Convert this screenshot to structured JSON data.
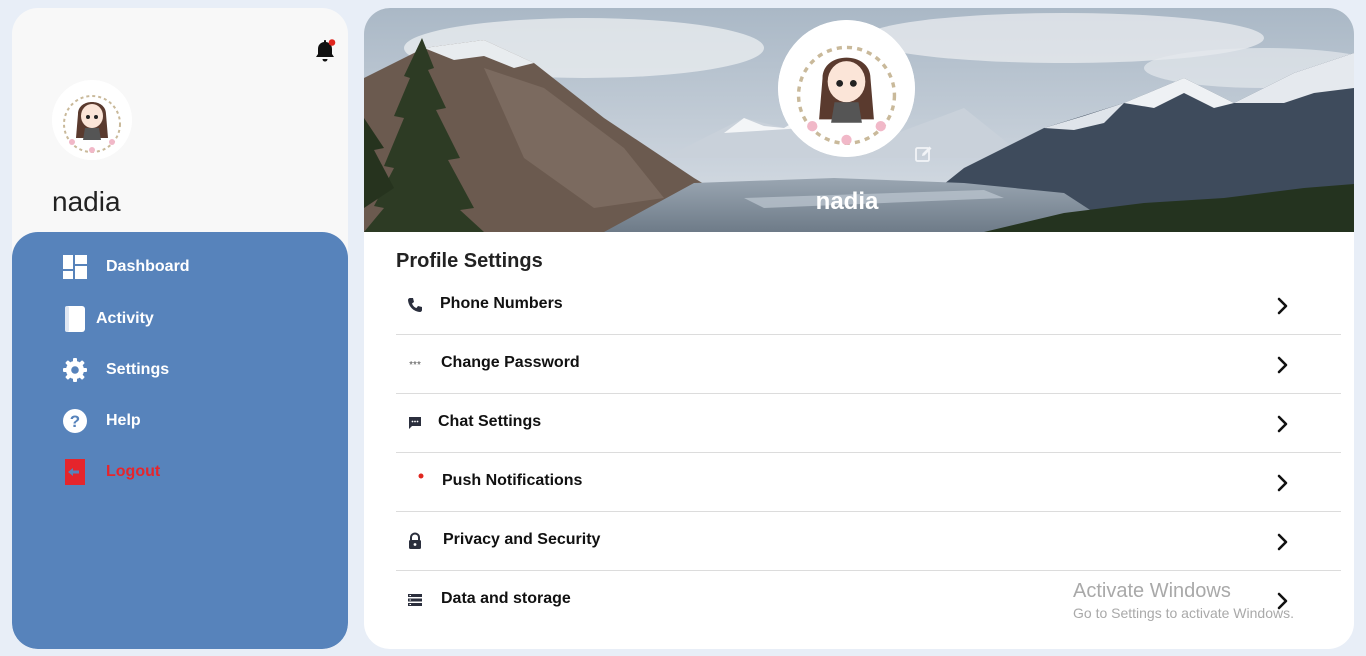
{
  "sidebar": {
    "user_name": "nadia",
    "nav": [
      {
        "label": "Dashboard",
        "icon": "dashboard-icon"
      },
      {
        "label": "Activity",
        "icon": "book-icon"
      },
      {
        "label": "Settings",
        "icon": "gear-icon"
      },
      {
        "label": "Help",
        "icon": "question-icon"
      },
      {
        "label": "Logout",
        "icon": "logout-icon"
      }
    ]
  },
  "profile": {
    "name": "nadia"
  },
  "settings": {
    "title": "Profile Settings",
    "items": [
      {
        "label": "Phone Numbers",
        "icon": "phone-icon"
      },
      {
        "label": "Change Password",
        "icon": "password-dots-icon"
      },
      {
        "label": "Chat Settings",
        "icon": "chat-icon"
      },
      {
        "label": "Push Notifications",
        "icon": "notification-dot-icon"
      },
      {
        "label": "Privacy and Security",
        "icon": "lock-icon"
      },
      {
        "label": "Data and storage",
        "icon": "storage-icon"
      }
    ]
  },
  "watermark": {
    "line1": "Activate Windows",
    "line2": "Go to Settings to activate Windows."
  },
  "colors": {
    "sidebar_nav_bg": "#5783bb",
    "logout_red": "#e5252c",
    "page_bg": "#e8eef7"
  }
}
